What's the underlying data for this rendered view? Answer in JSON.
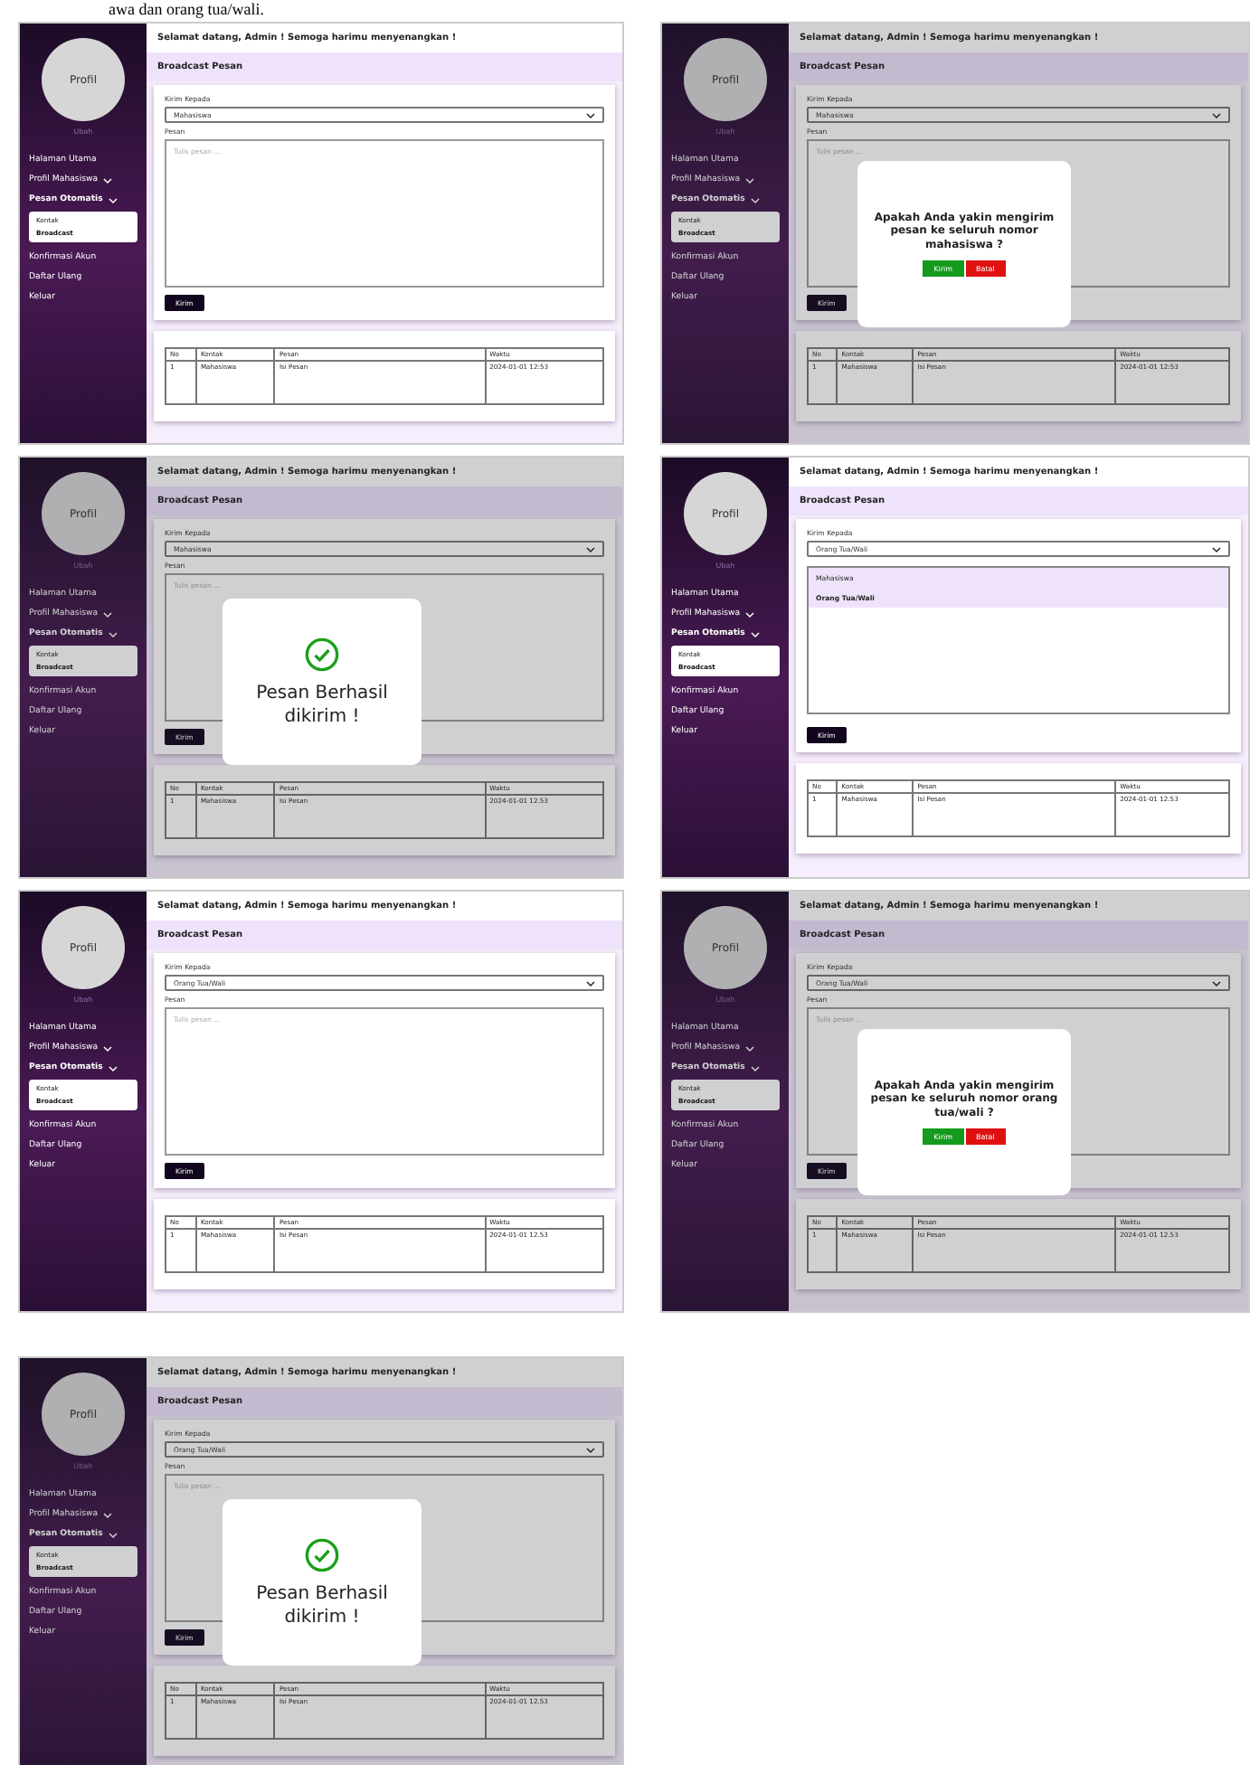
{
  "caption": "awa dan orang tua/wali.",
  "screens": [
    {
      "header": "Selamat datang, Admin ! Semoga harimu menyenangkan !",
      "page_title": "Broadcast Pesan",
      "profile": "Profil",
      "change_photo": "Ubah",
      "nav": [
        {
          "kind": "link",
          "label": "Halaman Utama",
          "selected": false
        },
        {
          "kind": "menu",
          "label": "Profil Mahasiswa",
          "selected": false
        },
        {
          "kind": "menu",
          "label": "Pesan Otomatis",
          "selected": true,
          "expanded": true,
          "children": [
            {
              "label": "Kontak",
              "selected": false
            },
            {
              "label": "Broadcast",
              "selected": true
            }
          ]
        },
        {
          "kind": "link",
          "label": "Konfirmasi Akun",
          "selected": false
        },
        {
          "kind": "link",
          "label": "Daftar Ulang",
          "selected": false
        },
        {
          "kind": "link",
          "label": "Keluar",
          "selected": false
        }
      ],
      "form": {
        "recipient_label": "Kirim Kepada",
        "recipient": "Mahasiswa",
        "message_label": "Pesan",
        "placeholder": "Tulis pesan ...",
        "send": "Kirim"
      },
      "table": {
        "columns": [
          "No",
          "Kontak",
          "Pesan",
          "Waktu"
        ],
        "rows": [
          [
            "1",
            "Mahasiswa",
            "Isi Pesan",
            "2024-01-01 12:53"
          ]
        ]
      }
    },
    {
      "header": "Selamat datang, Admin ! Semoga harimu menyenangkan !",
      "page_title": "Broadcast Pesan",
      "profile": "Profil",
      "change_photo": "Ubah",
      "nav": [
        {
          "kind": "link",
          "label": "Halaman Utama",
          "selected": false
        },
        {
          "kind": "menu",
          "label": "Profil Mahasiswa",
          "selected": false
        },
        {
          "kind": "menu",
          "label": "Pesan Otomatis",
          "selected": true,
          "expanded": true,
          "children": [
            {
              "label": "Kontak",
              "selected": false
            },
            {
              "label": "Broadcast",
              "selected": true
            }
          ]
        },
        {
          "kind": "link",
          "label": "Konfirmasi Akun",
          "selected": false
        },
        {
          "kind": "link",
          "label": "Daftar Ulang",
          "selected": false
        },
        {
          "kind": "link",
          "label": "Keluar",
          "selected": false
        }
      ],
      "form": {
        "recipient_label": "Kirim Kepada",
        "recipient": "Mahasiswa",
        "message_label": "Pesan",
        "placeholder": "Tulis pesan ...",
        "send": "Kirim"
      },
      "table": {
        "columns": [
          "No",
          "Kontak",
          "Pesan",
          "Waktu"
        ],
        "rows": [
          [
            "1",
            "Mahasiswa",
            "Isi Pesan",
            "2024-01-01 12:53"
          ]
        ]
      },
      "modal": {
        "kind": "confirm",
        "message": "Apakah Anda yakin mengirim pesan ke seluruh nomor mahasiswa ?",
        "buttons": [
          {
            "label": "Kirim",
            "kind": "confirm"
          },
          {
            "label": "Batal",
            "kind": "cancel"
          }
        ]
      }
    },
    {
      "header": "Selamat datang, Admin ! Semoga harimu menyenangkan !",
      "page_title": "Broadcast Pesan",
      "profile": "Profil",
      "change_photo": "Ubah",
      "nav": [
        {
          "kind": "link",
          "label": "Halaman Utama",
          "selected": false
        },
        {
          "kind": "menu",
          "label": "Profil Mahasiswa",
          "selected": false
        },
        {
          "kind": "menu",
          "label": "Pesan Otomatis",
          "selected": true,
          "expanded": true,
          "children": [
            {
              "label": "Kontak",
              "selected": false
            },
            {
              "label": "Broadcast",
              "selected": true
            }
          ]
        },
        {
          "kind": "link",
          "label": "Konfirmasi Akun",
          "selected": false
        },
        {
          "kind": "link",
          "label": "Daftar Ulang",
          "selected": false
        },
        {
          "kind": "link",
          "label": "Keluar",
          "selected": false
        }
      ],
      "form": {
        "recipient_label": "Kirim Kepada",
        "recipient": "Mahasiswa",
        "message_label": "Pesan",
        "placeholder": "Tulis pesan ...",
        "send": "Kirim"
      },
      "table": {
        "columns": [
          "No",
          "Kontak",
          "Pesan",
          "Waktu"
        ],
        "rows": [
          [
            "1",
            "Mahasiswa",
            "Isi Pesan",
            "2024-01-01 12.53"
          ]
        ]
      },
      "modal": {
        "kind": "success",
        "message": "Pesan Berhasil dikirim !"
      }
    },
    {
      "header": "Selamat datang, Admin ! Semoga harimu menyenangkan !",
      "page_title": "Broadcast Pesan",
      "profile": "Profil",
      "change_photo": "Ubah",
      "nav": [
        {
          "kind": "link",
          "label": "Halaman Utama",
          "selected": false
        },
        {
          "kind": "menu",
          "label": "Profil Mahasiswa",
          "selected": false
        },
        {
          "kind": "menu",
          "label": "Pesan Otomatis",
          "selected": true,
          "expanded": true,
          "children": [
            {
              "label": "Kontak",
              "selected": false
            },
            {
              "label": "Broadcast",
              "selected": true
            }
          ]
        },
        {
          "kind": "link",
          "label": "Konfirmasi Akun",
          "selected": false
        },
        {
          "kind": "link",
          "label": "Daftar Ulang",
          "selected": false
        },
        {
          "kind": "link",
          "label": "Keluar",
          "selected": false
        }
      ],
      "form": {
        "recipient_label": "Kirim Kepada",
        "recipient": "Orang Tua/Wali",
        "send": "Kirim"
      },
      "dropdown": [
        {
          "label": "Mahasiswa",
          "selected": false
        },
        {
          "label": "Orang Tua/Wali",
          "selected": true
        }
      ],
      "table": {
        "columns": [
          "No",
          "Kontak",
          "Pesan",
          "Waktu"
        ],
        "rows": [
          [
            "1",
            "Mahasiswa",
            "Isi Pesan",
            "2024-01-01 12.53"
          ]
        ]
      }
    },
    {
      "header": "Selamat datang, Admin ! Semoga harimu menyenangkan !",
      "page_title": "Broadcast Pesan",
      "profile": "Profil",
      "change_photo": "Ubah",
      "nav": [
        {
          "kind": "link",
          "label": "Halaman Utama",
          "selected": false
        },
        {
          "kind": "menu",
          "label": "Profil Mahasiswa",
          "selected": false
        },
        {
          "kind": "menu",
          "label": "Pesan Otomatis",
          "selected": true,
          "expanded": true,
          "children": [
            {
              "label": "Kontak",
              "selected": false
            },
            {
              "label": "Broadcast",
              "selected": true
            }
          ]
        },
        {
          "kind": "link",
          "label": "Konfirmasi Akun",
          "selected": false
        },
        {
          "kind": "link",
          "label": "Daftar Ulang",
          "selected": false
        },
        {
          "kind": "link",
          "label": "Keluar",
          "selected": false
        }
      ],
      "form": {
        "recipient_label": "Kirim Kepada",
        "recipient": "Orang Tua/Wali",
        "message_label": "Pesan",
        "placeholder": "Tulis pesan ...",
        "send": "Kirim"
      },
      "table": {
        "columns": [
          "No",
          "Kontak",
          "Pesan",
          "Waktu"
        ],
        "rows": [
          [
            "1",
            "Mahasiswa",
            "Isi Pesan",
            "2024-01-01 12.53"
          ]
        ]
      }
    },
    {
      "header": "Selamat datang, Admin ! Semoga harimu menyenangkan !",
      "page_title": "Broadcast Pesan",
      "profile": "Profil",
      "change_photo": "Ubah",
      "nav": [
        {
          "kind": "link",
          "label": "Halaman Utama",
          "selected": false
        },
        {
          "kind": "menu",
          "label": "Profil Mahasiswa",
          "selected": false
        },
        {
          "kind": "menu",
          "label": "Pesan Otomatis",
          "selected": true,
          "expanded": true,
          "children": [
            {
              "label": "Kontak",
              "selected": false
            },
            {
              "label": "Broadcast",
              "selected": true
            }
          ]
        },
        {
          "kind": "link",
          "label": "Konfirmasi Akun",
          "selected": false
        },
        {
          "kind": "link",
          "label": "Daftar Ulang",
          "selected": false
        },
        {
          "kind": "link",
          "label": "Keluar",
          "selected": false
        }
      ],
      "form": {
        "recipient_label": "Kirim Kepada",
        "recipient": "Orang Tua/Wali",
        "message_label": "Pesan",
        "placeholder": "Tulis pesan ...",
        "send": "Kirim"
      },
      "table": {
        "columns": [
          "No",
          "Kontak",
          "Pesan",
          "Waktu"
        ],
        "rows": [
          [
            "1",
            "Mahasiswa",
            "Isi Pesan",
            "2024-01-01 12.53"
          ]
        ]
      },
      "modal": {
        "kind": "confirm",
        "message": "Apakah Anda yakin mengirim pesan ke seluruh nomor orang tua/wali ?",
        "buttons": [
          {
            "label": "Kirim",
            "kind": "confirm"
          },
          {
            "label": "Batal",
            "kind": "cancel"
          }
        ]
      }
    },
    {
      "header": "Selamat datang, Admin ! Semoga harimu menyenangkan !",
      "page_title": "Broadcast Pesan",
      "profile": "Profil",
      "change_photo": "Ubah",
      "nav": [
        {
          "kind": "link",
          "label": "Halaman Utama",
          "selected": false
        },
        {
          "kind": "menu",
          "label": "Profil Mahasiswa",
          "selected": false
        },
        {
          "kind": "menu",
          "label": "Pesan Otomatis",
          "selected": true,
          "expanded": true,
          "children": [
            {
              "label": "Kontak",
              "selected": false
            },
            {
              "label": "Broadcast",
              "selected": true
            }
          ]
        },
        {
          "kind": "link",
          "label": "Konfirmasi Akun",
          "selected": false
        },
        {
          "kind": "link",
          "label": "Daftar Ulang",
          "selected": false
        },
        {
          "kind": "link",
          "label": "Keluar",
          "selected": false
        }
      ],
      "form": {
        "recipient_label": "Kirim Kepada",
        "recipient": "Orang Tua/Wali",
        "message_label": "Pesan",
        "placeholder": "Tulis pesan ...",
        "send": "Kirim"
      },
      "table": {
        "columns": [
          "No",
          "Kontak",
          "Pesan",
          "Waktu"
        ],
        "rows": [
          [
            "1",
            "Mahasiswa",
            "Isi Pesan",
            "2024-01-01 12.53"
          ]
        ]
      },
      "modal": {
        "kind": "success",
        "message": "Pesan Berhasil dikirim !"
      }
    }
  ]
}
